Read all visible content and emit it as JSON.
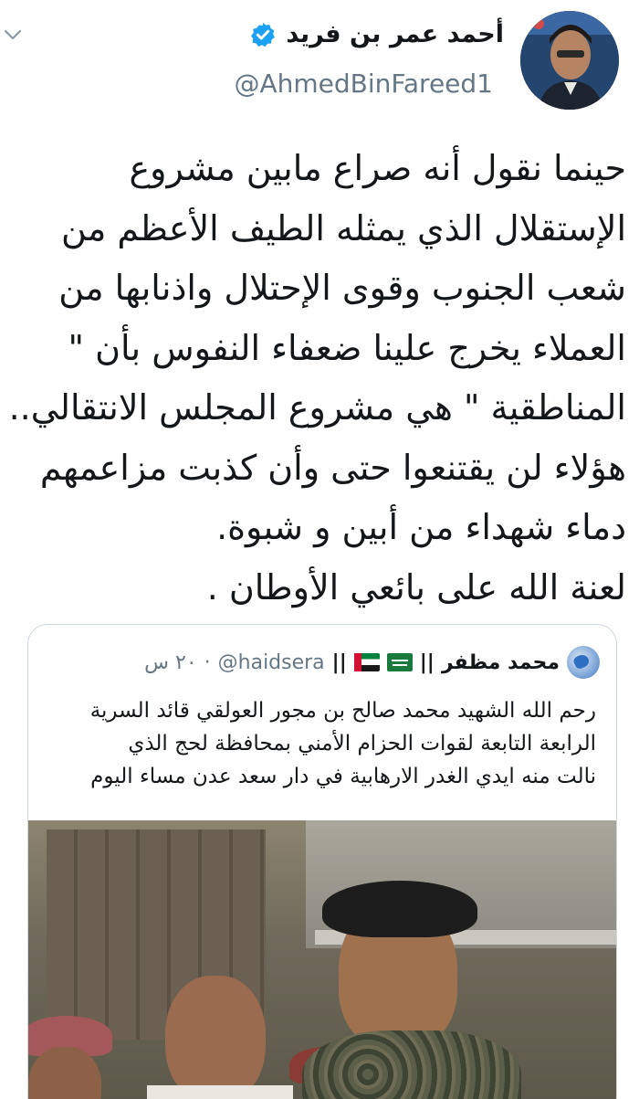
{
  "header": {
    "display_name": "أحمد عمر بن فريد",
    "handle": "@AhmedBinFareed1",
    "verified_icon": "verified-badge-icon",
    "menu_icon": "chevron-down-icon"
  },
  "tweet": {
    "lines": [
      "حينما نقول أنه صراع مابين مشروع",
      "الإستقلال الذي يمثله الطيف الأعظم من",
      "شعب الجنوب وقوى الإحتلال واذنابها من",
      "العملاء يخرج علينا ضعفاء النفوس بأن \"",
      "المناطقية \" هي مشروع المجلس الانتقالي.. !",
      "هؤلاء لن يقتنعوا حتى وأن كذبت مزاعمهم",
      "دماء شهداء من أبين و شبوة.",
      "لعنة الله على بائعي الأوطان ."
    ]
  },
  "quote": {
    "name": "محمد مظفر",
    "separator": "||",
    "handle": "@haidsera",
    "time": "٢٠ س",
    "flags": [
      "ae-flag-icon",
      "sa-flag-icon"
    ],
    "lines": [
      "رحم الله الشهيد محمد صالح بن مجور العولقي قائد السرية",
      "الرابعة التابعة لقوات الحزام الأمني بمحافظة لحج الذي",
      "نالت منه ايدي الغدر الارهابية في دار سعد عدن مساء اليوم"
    ]
  },
  "colors": {
    "text": "#14171a",
    "secondary": "#657786",
    "verified": "#1da1f2",
    "border": "#ccd6dd"
  }
}
